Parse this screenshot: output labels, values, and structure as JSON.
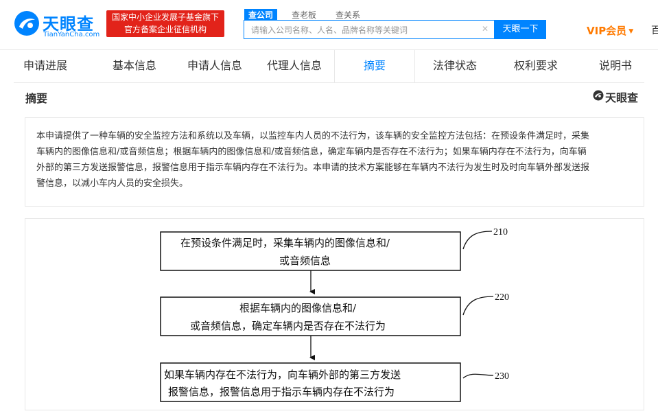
{
  "header": {
    "logo_cn": "天眼查",
    "logo_en": "TianYanCha.com",
    "slogan_line1": "国家中小企业发展子基金旗下",
    "slogan_line2": "官方备案企业征信机构",
    "search_tabs": [
      "查公司",
      "查老板",
      "查关系"
    ],
    "search_placeholder": "请输入公司名称、人名、品牌名称等关键词",
    "search_button": "天眼一下",
    "vip_label": "VIP会员",
    "cut_text": "百"
  },
  "subnav": {
    "items": [
      "申请进展",
      "基本信息",
      "申请人信息",
      "代理人信息",
      "摘要",
      "法律状态",
      "权利要求",
      "说明书"
    ],
    "active_index": 4
  },
  "section": {
    "title": "摘要",
    "brand": "天眼查"
  },
  "abstract": {
    "lines": [
      "本申请提供了一种车辆的安全监控方法和系统以及车辆，以监控车内人员的不法行为，该车辆的安全监控方法包括：在预设条件满足时，采集",
      "车辆内的图像信息和/或音频信息；根据车辆内的图像信息和/或音频信息，确定车辆内是否存在不法行为；如果车辆内存在不法行为，向车辆",
      "外部的第三方发送报警信息，报警信息用于指示车辆内存在不法行为。本申请的技术方案能够在车辆内不法行为发生时及时向车辆外部发送报",
      "警信息，以减小车内人员的安全损失。"
    ]
  },
  "figure": {
    "steps": [
      {
        "label": "210",
        "line1": "在预设条件满足时，采集车辆内的图像信息和/",
        "line2": "或音频信息"
      },
      {
        "label": "220",
        "line1": "根据车辆内的图像信息和/",
        "line2": "或音频信息，确定车辆内是否存在不法行为"
      },
      {
        "label": "230",
        "line1": "如果车辆内存在不法行为，向车辆外部的第三方发送",
        "line2": "报警信息，报警信息用于指示车辆内存在不法行为"
      }
    ]
  },
  "colors": {
    "brand_blue": "#0084ff",
    "slogan_red": "#e2231a",
    "vip_orange": "#ff7a00"
  }
}
